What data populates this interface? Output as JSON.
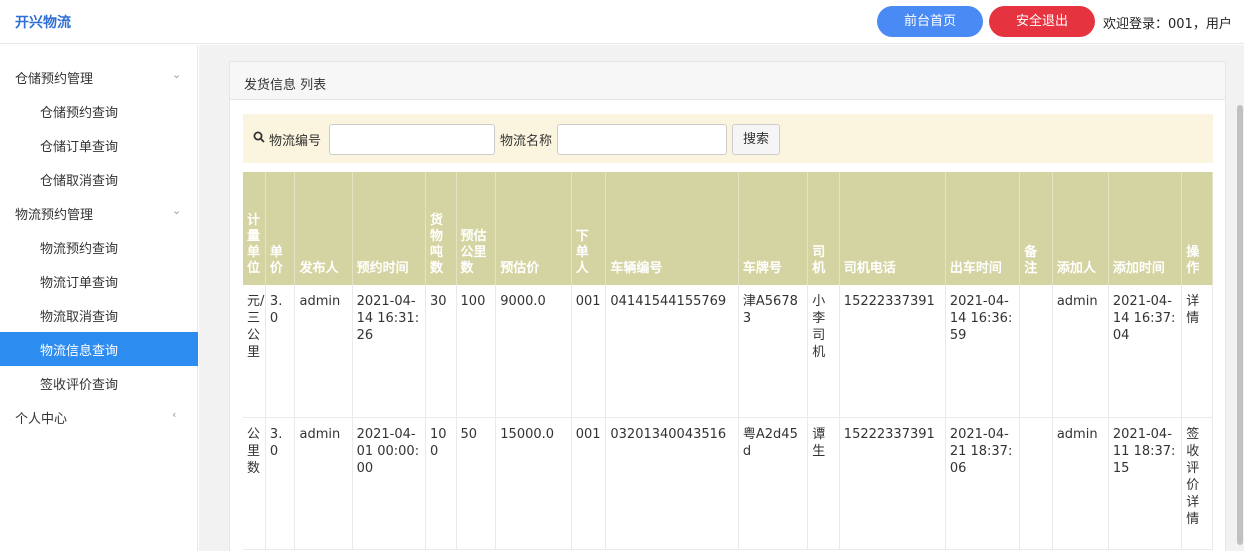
{
  "header": {
    "brand": "开兴物流",
    "home_button": "前台首页",
    "logout_button": "安全退出",
    "welcome": "欢迎登录：001，用户"
  },
  "sidebar": {
    "groups": [
      {
        "label": "仓储预约管理",
        "arrow": "⌄",
        "items": [
          "仓储预约查询",
          "仓储订单查询",
          "仓储取消查询"
        ]
      },
      {
        "label": "物流预约管理",
        "arrow": "⌄",
        "items": [
          "物流预约查询",
          "物流订单查询",
          "物流取消查询",
          "物流信息查询",
          "签收评价查询"
        ]
      },
      {
        "label": "个人中心",
        "arrow": "‹",
        "items": []
      }
    ],
    "active_item": "物流信息查询"
  },
  "panel": {
    "title": "发货信息 列表"
  },
  "search": {
    "label1": "物流编号",
    "placeholder1": "",
    "label2": "物流名称",
    "placeholder2": "",
    "button": "搜索"
  },
  "table": {
    "headers": [
      "计量单位",
      "单价",
      "发布人",
      "预约时间",
      "货物吨数",
      "预估公里数",
      "预估价",
      "下单人",
      "车辆编号",
      "车牌号",
      "司机",
      "司机电话",
      "出车时间",
      "备注",
      "添加人",
      "添加时间",
      "操作"
    ],
    "rows": [
      {
        "cells": [
          "元/三公里",
          "3.0",
          "admin",
          "2021-04-14 16:31:26",
          "30",
          "100",
          "9000.0",
          "001",
          "04141544155769",
          "津A56783",
          "小李司机",
          "15222337391",
          "2021-04-14 16:36:59",
          "",
          "admin",
          "2021-04-14 16:37:04",
          "详情"
        ]
      },
      {
        "cells": [
          "公里数",
          "3.0",
          "admin",
          "2021-04-01 00:00:00",
          "100",
          "50",
          "15000.0",
          "001",
          "03201340043516",
          "粤A2d45d",
          "谭生",
          "15222337391",
          "2021-04-21 18:37:06",
          "",
          "admin",
          "2021-04-11 18:37:15",
          "签收评价详情"
        ]
      }
    ]
  }
}
